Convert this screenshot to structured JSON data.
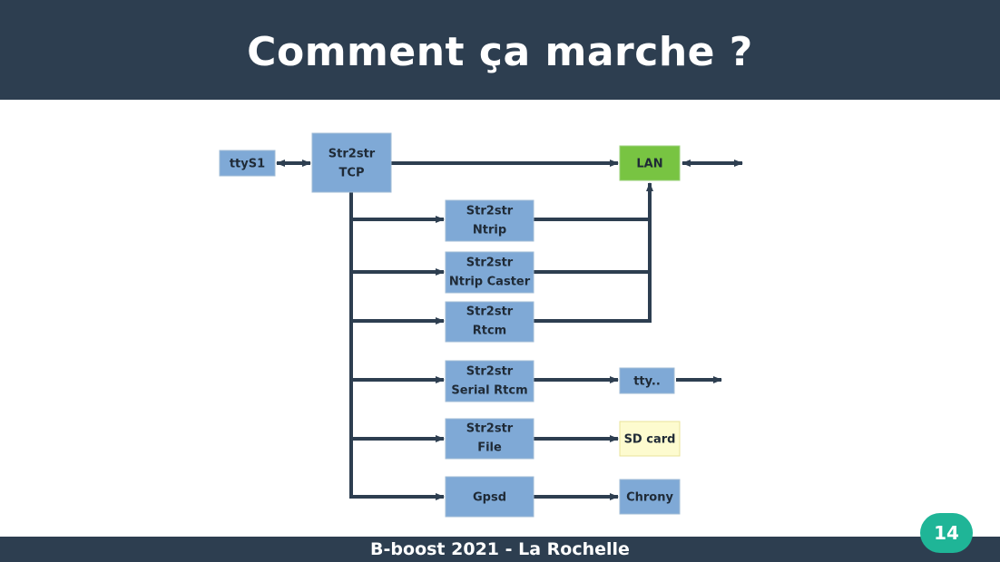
{
  "slide": {
    "title": "Comment ça marche ?",
    "footer": "B-boost 2021 - La Rochelle",
    "page_number": "14"
  },
  "colors": {
    "header_bg": "#2d3e50",
    "box_blue": "#7fa9d6",
    "box_green": "#78c442",
    "box_yellow": "#fdfbcf",
    "arrow": "#2d3e50",
    "badge": "#1fb597"
  },
  "diagram": {
    "nodes": {
      "ttys1": {
        "lines": [
          "ttyS1"
        ]
      },
      "str2str_tcp": {
        "lines": [
          "Str2str",
          "TCP"
        ]
      },
      "lan": {
        "lines": [
          "LAN"
        ]
      },
      "str2str_ntrip": {
        "lines": [
          "Str2str",
          "Ntrip"
        ]
      },
      "str2str_ntrip_caster": {
        "lines": [
          "Str2str",
          "Ntrip Caster"
        ]
      },
      "str2str_rtcm": {
        "lines": [
          "Str2str",
          "Rtcm"
        ]
      },
      "str2str_serial_rtcm": {
        "lines": [
          "Str2str",
          "Serial Rtcm"
        ]
      },
      "tty": {
        "lines": [
          "tty.."
        ]
      },
      "str2str_file": {
        "lines": [
          "Str2str",
          "File"
        ]
      },
      "sd_card": {
        "lines": [
          "SD card"
        ]
      },
      "gpsd": {
        "lines": [
          "Gpsd"
        ]
      },
      "chrony": {
        "lines": [
          "Chrony"
        ]
      }
    },
    "edges": [
      {
        "from": "ttys1",
        "to": "str2str_tcp",
        "bidirectional": true
      },
      {
        "from": "str2str_tcp",
        "to": "lan"
      },
      {
        "from": "lan",
        "to": "external",
        "bidirectional": true
      },
      {
        "from": "str2str_tcp",
        "to": "str2str_ntrip"
      },
      {
        "from": "str2str_tcp",
        "to": "str2str_ntrip_caster"
      },
      {
        "from": "str2str_tcp",
        "to": "str2str_rtcm"
      },
      {
        "from": "str2str_tcp",
        "to": "str2str_serial_rtcm"
      },
      {
        "from": "str2str_tcp",
        "to": "str2str_file"
      },
      {
        "from": "str2str_tcp",
        "to": "gpsd"
      },
      {
        "from": "str2str_ntrip",
        "to": "lan"
      },
      {
        "from": "str2str_ntrip_caster",
        "to": "lan"
      },
      {
        "from": "str2str_rtcm",
        "to": "lan"
      },
      {
        "from": "str2str_serial_rtcm",
        "to": "tty"
      },
      {
        "from": "tty",
        "to": "external"
      },
      {
        "from": "str2str_file",
        "to": "sd_card"
      },
      {
        "from": "gpsd",
        "to": "chrony"
      }
    ]
  }
}
